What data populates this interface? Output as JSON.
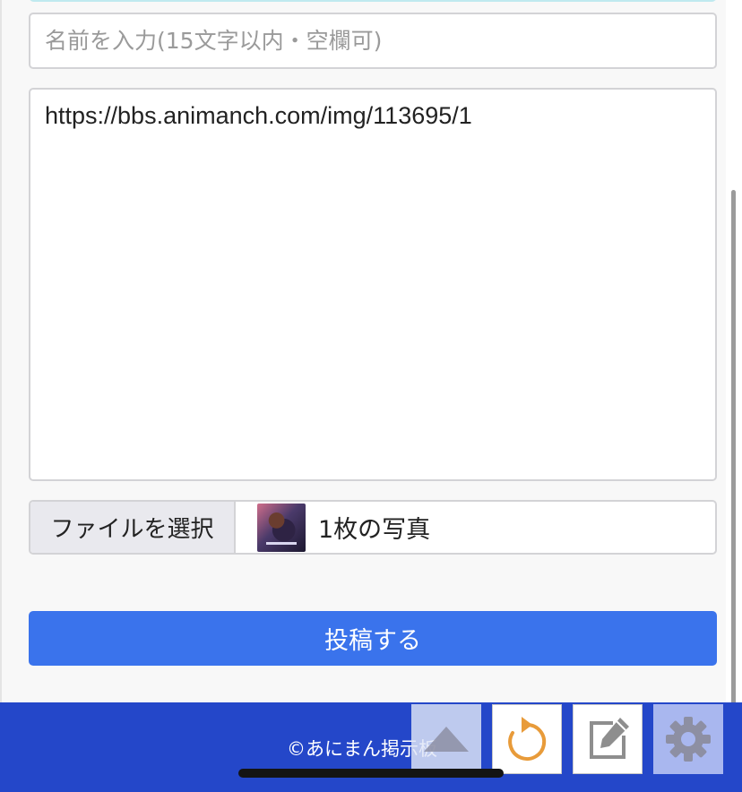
{
  "form": {
    "name_placeholder": "名前を入力(15文字以内・空欄可)",
    "name_value": "",
    "body_value": "https://bbs.animanch.com/img/113695/1",
    "file_button_label": "ファイルを選択",
    "file_status": "1枚の写真",
    "submit_label": "投稿する"
  },
  "footer": {
    "copyright": "©あにまん掲示板"
  },
  "icons": {
    "scroll_top": "triangle-up-icon",
    "reload": "reload-icon",
    "edit": "edit-icon",
    "settings": "gear-icon"
  },
  "colors": {
    "submit": "#3a73ec",
    "footer": "#2447c9",
    "reload_accent": "#e89b3a"
  }
}
